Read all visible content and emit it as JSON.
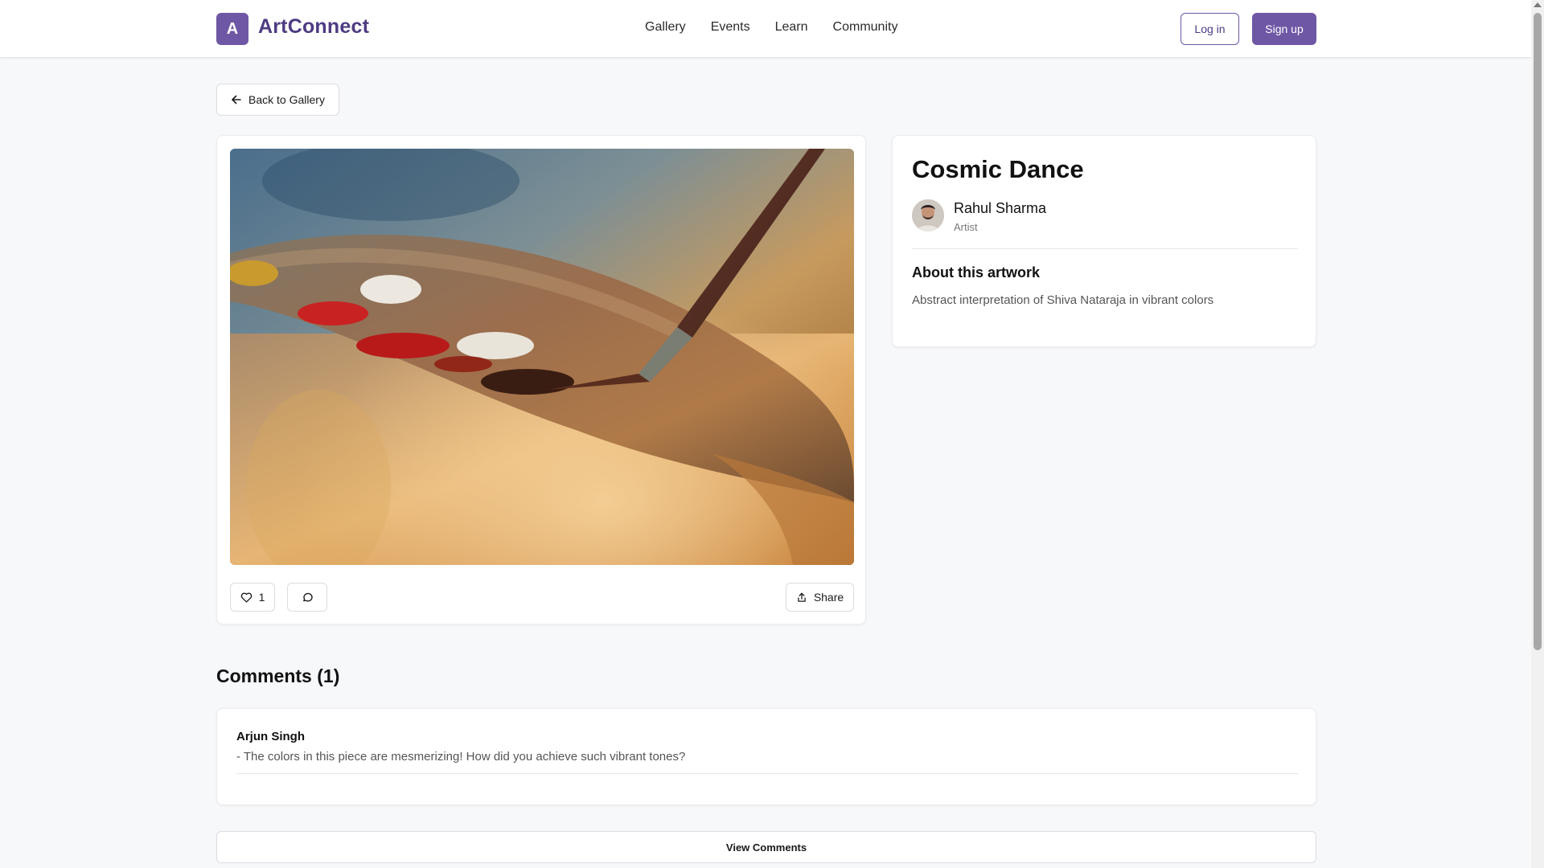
{
  "brand": {
    "logo_letter": "A",
    "name": "ArtConnect"
  },
  "nav": {
    "items": [
      "Gallery",
      "Events",
      "Learn",
      "Community"
    ]
  },
  "auth": {
    "login_label": "Log in",
    "signup_label": "Sign up"
  },
  "back_button": {
    "label": "Back to Gallery"
  },
  "artwork": {
    "title": "Cosmic Dance",
    "artist_name": "Rahul Sharma",
    "artist_role": "Artist",
    "about_heading": "About this artwork",
    "description": "Abstract interpretation of Shiva Nataraja in vibrant colors",
    "likes": "1",
    "share_label": "Share"
  },
  "comments": {
    "heading": "Comments (1)",
    "items": [
      {
        "author": "Arjun Singh",
        "text": "- The colors in this piece are mesmerizing! How did you achieve such vibrant tones?"
      }
    ],
    "view_label": "View Comments"
  },
  "colors": {
    "accent": "#6e57a5",
    "brand_text": "#4e3b82",
    "background": "#f7f8fa"
  },
  "icons": [
    "arrow-left-icon",
    "heart-icon",
    "comment-icon",
    "share-icon"
  ]
}
